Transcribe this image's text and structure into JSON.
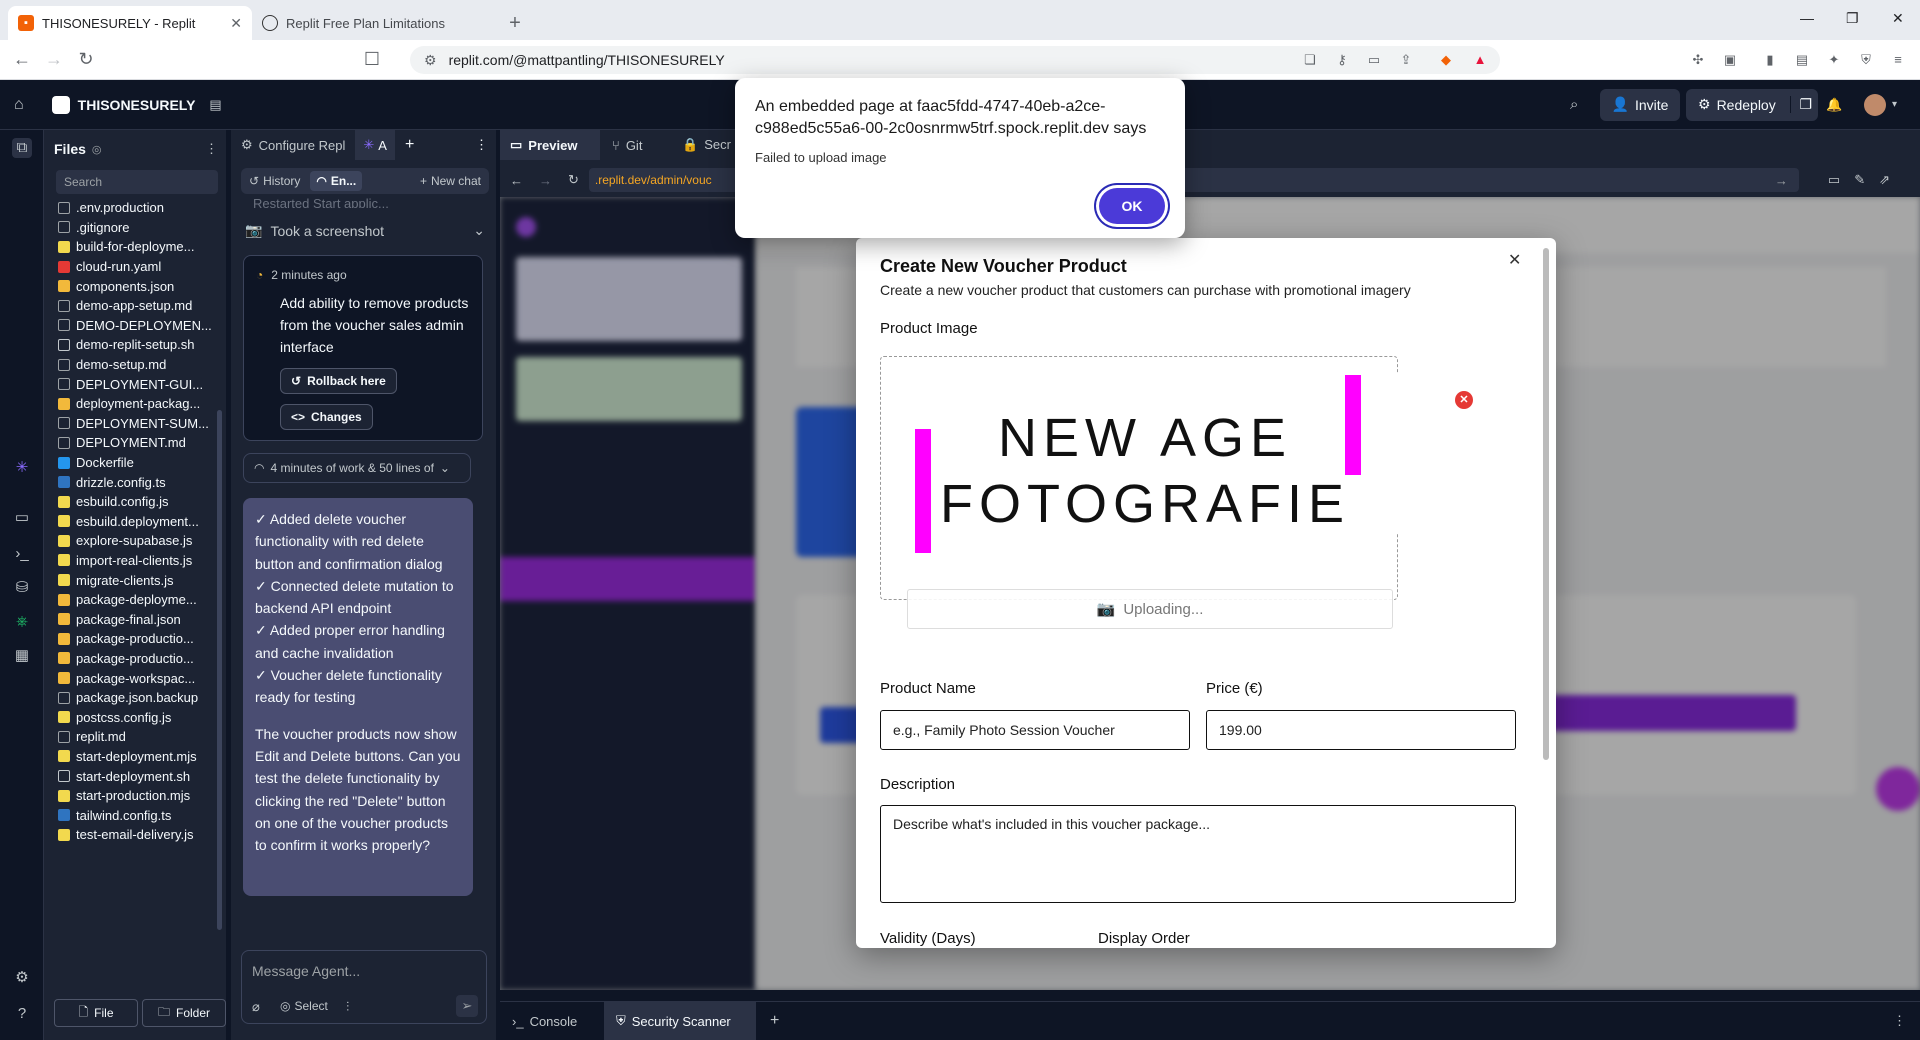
{
  "browser": {
    "tabs": [
      {
        "title": "THISONESURELY - Replit",
        "active": true
      },
      {
        "title": "Replit Free Plan Limitations",
        "active": false
      }
    ],
    "url": "replit.com/@mattpantling/THISONESURELY"
  },
  "header": {
    "project_name": "THISONESURELY",
    "invite_label": "Invite",
    "redeploy_label": "Redeploy"
  },
  "files": {
    "title": "Files",
    "search_placeholder": "Search",
    "items": [
      {
        "name": ".env.production",
        "icon": "file-icon"
      },
      {
        "name": ".gitignore",
        "icon": "file-icon"
      },
      {
        "name": "build-for-deployme...",
        "icon": "js-icon"
      },
      {
        "name": "cloud-run.yaml",
        "icon": "yaml-icon"
      },
      {
        "name": "components.json",
        "icon": "json-icon"
      },
      {
        "name": "demo-app-setup.md",
        "icon": "md-icon"
      },
      {
        "name": "DEMO-DEPLOYMEN...",
        "icon": "md-icon"
      },
      {
        "name": "demo-replit-setup.sh",
        "icon": "sh-icon"
      },
      {
        "name": "demo-setup.md",
        "icon": "md-icon"
      },
      {
        "name": "DEPLOYMENT-GUI...",
        "icon": "md-icon"
      },
      {
        "name": "deployment-packag...",
        "icon": "json-icon"
      },
      {
        "name": "DEPLOYMENT-SUM...",
        "icon": "md-icon"
      },
      {
        "name": "DEPLOYMENT.md",
        "icon": "md-icon"
      },
      {
        "name": "Dockerfile",
        "icon": "docker-icon"
      },
      {
        "name": "drizzle.config.ts",
        "icon": "ts-icon"
      },
      {
        "name": "esbuild.config.js",
        "icon": "js-icon"
      },
      {
        "name": "esbuild.deployment...",
        "icon": "js-icon"
      },
      {
        "name": "explore-supabase.js",
        "icon": "js-icon"
      },
      {
        "name": "import-real-clients.js",
        "icon": "js-icon"
      },
      {
        "name": "migrate-clients.js",
        "icon": "js-icon"
      },
      {
        "name": "package-deployme...",
        "icon": "json-icon"
      },
      {
        "name": "package-final.json",
        "icon": "json-icon"
      },
      {
        "name": "package-productio...",
        "icon": "json-icon"
      },
      {
        "name": "package-productio...",
        "icon": "json-icon"
      },
      {
        "name": "package-workspac...",
        "icon": "json-icon"
      },
      {
        "name": "package.json.backup",
        "icon": "md-icon"
      },
      {
        "name": "postcss.config.js",
        "icon": "js-icon"
      },
      {
        "name": "replit.md",
        "icon": "md-icon"
      },
      {
        "name": "start-deployment.mjs",
        "icon": "js-icon"
      },
      {
        "name": "start-deployment.sh",
        "icon": "sh-icon"
      },
      {
        "name": "start-production.mjs",
        "icon": "js-icon"
      },
      {
        "name": "tailwind.config.ts",
        "icon": "ts-icon"
      },
      {
        "name": "test-email-delivery.js",
        "icon": "js-icon"
      }
    ],
    "new_file_label": "File",
    "new_folder_label": "Folder"
  },
  "agent": {
    "tabs": [
      "Configure Repl",
      "A"
    ],
    "history_label": "History",
    "env_label": "En...",
    "new_chat_label": "New chat",
    "restarted_text": "Restarted Start applic...",
    "screenshot_text": "Took a screenshot",
    "checkpoint_time": "2 minutes ago",
    "checkpoint_text": "Add ability to remove products from the voucher sales admin interface",
    "rollback_label": "Rollback here",
    "changes_label": "Changes",
    "work_summary": "4 minutes of work & 50 lines of",
    "message_lines": [
      "✓ Added delete voucher functionality with red delete button and confirmation dialog",
      "✓ Connected delete mutation to backend API endpoint",
      "✓ Added proper error handling and cache invalidation",
      "✓ Voucher delete functionality ready for testing"
    ],
    "message_para": "The voucher products now show Edit and Delete buttons. Can you test the delete functionality by clicking the red \"Delete\" button on one of the voucher products to confirm it works properly?",
    "input_placeholder": "Message Agent...",
    "select_label": "Select"
  },
  "preview": {
    "tabs": [
      "Preview",
      "Git",
      "Secr"
    ],
    "url": ".replit.dev/admin/vouc"
  },
  "modal": {
    "title": "Create New Voucher Product",
    "subtitle": "Create a new voucher product that customers can purchase with promotional imagery",
    "image_label": "Product Image",
    "logo_line1": "NEW AGE",
    "logo_line2": "FOTOGRAFIE",
    "uploading_text": "Uploading...",
    "name_label": "Product Name",
    "name_placeholder": "e.g., Family Photo Session Voucher",
    "price_label": "Price (€)",
    "price_value": "199.00",
    "desc_label": "Description",
    "desc_placeholder": "Describe what's included in this voucher package...",
    "validity_label": "Validity (Days)",
    "order_label": "Display Order"
  },
  "alert": {
    "title": "An embedded page at faac5fdd-4747-40eb-a2ce-c988ed5c55a6-00-2c0osnrmw5trf.spock.replit.dev says",
    "message": "Failed to upload image",
    "ok_label": "OK"
  },
  "bottom": {
    "tabs": [
      "Console",
      "Security Scanner"
    ]
  },
  "colors": {
    "accent_purple": "#7b2cff",
    "ok_button": "#4b3ad8",
    "magenta": "#ff00ff",
    "remove_red": "#e53935"
  }
}
